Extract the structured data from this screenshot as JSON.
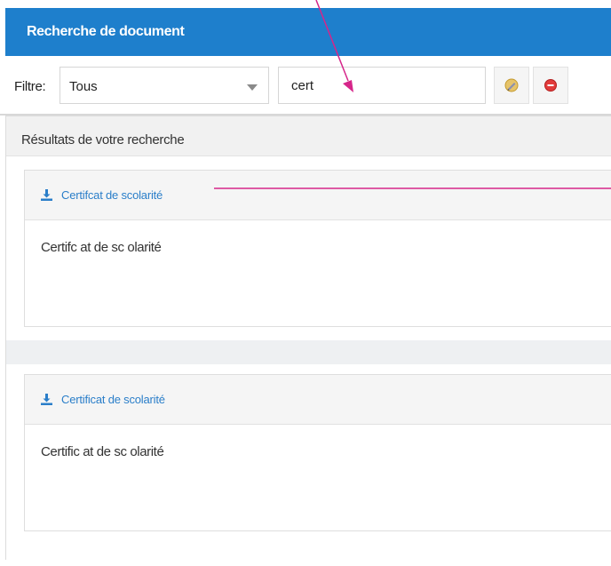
{
  "header": {
    "title": "Recherche de document"
  },
  "filter": {
    "label": "Filtre:",
    "selected": "Tous",
    "search_value": "cert"
  },
  "results": {
    "title": "Résultats de votre recherche",
    "items": [
      {
        "link_label": "Certifcat de scolarité",
        "description": "Certifc at de sc olarité"
      },
      {
        "link_label": "Certificat de scolarité",
        "description": "Certific at de sc olarité"
      }
    ]
  },
  "colors": {
    "header_bg": "#1e7fcc",
    "link": "#2a7ec9",
    "annotation": "#d6268a",
    "clear_button": "#e23b3b"
  },
  "icons": {
    "tool_button_1": "pencil-edit-icon",
    "tool_button_2": "clear-red-circle-icon",
    "result_link": "download-icon"
  }
}
